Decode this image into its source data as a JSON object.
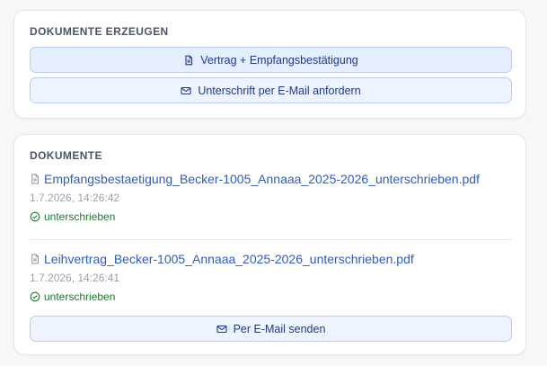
{
  "generate": {
    "title": "DOKUMENTE ERZEUGEN",
    "contract_button": "Vertrag + Empfangsbestätigung",
    "signature_button": "Unterschrift per E-Mail anfordern"
  },
  "documents": {
    "title": "DOKUMENTE",
    "items": [
      {
        "filename": "Empfangsbestaetigung_Becker-1005_Annaaa_2025-2026_unterschrieben.pdf",
        "timestamp": "1.7.2026, 14:26:42",
        "status": "unterschrieben"
      },
      {
        "filename": "Leihvertrag_Becker-1005_Annaaa_2025-2026_unterschrieben.pdf",
        "timestamp": "1.7.2026, 14:26:41",
        "status": "unterschrieben"
      }
    ],
    "send_button": "Per E-Mail senden"
  },
  "colors": {
    "accent": "#2c5cc5",
    "button_bg": "#e4eeff",
    "success": "#1b7a2f"
  },
  "icons": {
    "document": "document-icon",
    "mail": "mail-icon",
    "check": "check-circle-icon"
  }
}
